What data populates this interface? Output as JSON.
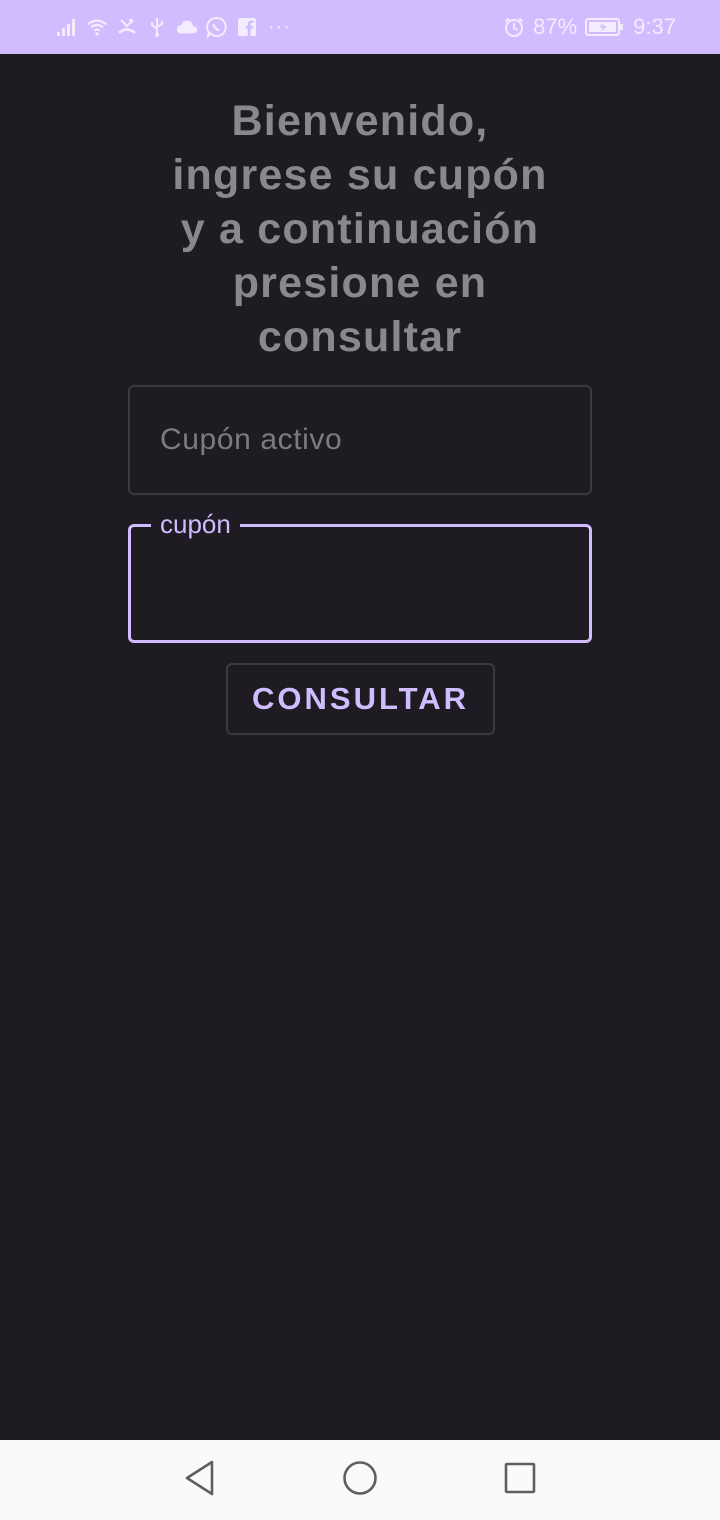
{
  "status_bar": {
    "icons": [
      "signal-icon",
      "wifi-icon",
      "missed-call-icon",
      "usb-icon",
      "cloud-icon",
      "whatsapp-icon",
      "facebook-icon"
    ],
    "more_indicator": "···",
    "battery_percent": "87%",
    "time": "9:37"
  },
  "main": {
    "welcome_text": "Bienvenido,\ningrese su cupón\ny a continuación\npresione en\nconsultar",
    "active_coupon_field": {
      "placeholder": "Cupón activo",
      "value": ""
    },
    "coupon_field": {
      "label": "cupón",
      "value": ""
    },
    "consult_button_label": "CONSULTAR"
  },
  "nav_bar": {
    "buttons": [
      "back-icon",
      "home-icon",
      "recents-icon"
    ]
  },
  "colors": {
    "accent": "#d0bcff",
    "background": "#1e1c22",
    "title_text": "#8a888d",
    "outline": "#3c3a40",
    "nav_bar_background": "#fafafa"
  }
}
